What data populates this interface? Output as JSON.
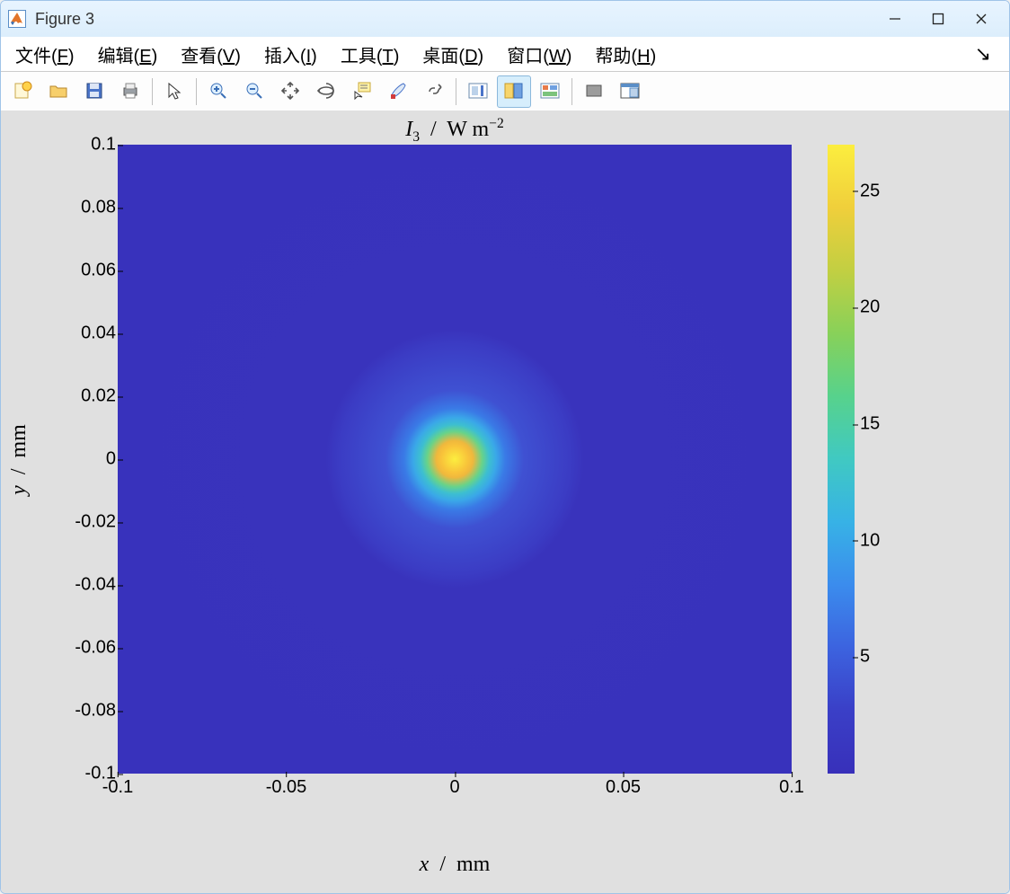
{
  "window": {
    "title": "Figure 3"
  },
  "menubar": {
    "items": [
      {
        "pre": "文件(",
        "u": "F",
        "post": ")"
      },
      {
        "pre": "编辑(",
        "u": "E",
        "post": ")"
      },
      {
        "pre": "查看(",
        "u": "V",
        "post": ")"
      },
      {
        "pre": "插入(",
        "u": "I",
        "post": ")"
      },
      {
        "pre": "工具(",
        "u": "T",
        "post": ")"
      },
      {
        "pre": "桌面(",
        "u": "D",
        "post": ")"
      },
      {
        "pre": "窗口(",
        "u": "W",
        "post": ")"
      },
      {
        "pre": "帮助(",
        "u": "H",
        "post": ")"
      }
    ]
  },
  "toolbar": {
    "buttons": [
      "new-figure",
      "open",
      "save",
      "print",
      "|",
      "pointer",
      "|",
      "zoom-in",
      "zoom-out",
      "pan",
      "rotate-3d",
      "data-cursor",
      "brush",
      "link",
      "|",
      "colorbar",
      "legend",
      "plot-tools",
      "|",
      "hide-tools",
      "dock"
    ],
    "pressed": "legend"
  },
  "chart_data": {
    "type": "heatmap",
    "title_html": "<i>I</i><span class='unit-sub'>3</span>&nbsp;&nbsp;/&nbsp; W m<span class='unit-sup'>−2</span>",
    "xlabel_html": "<i>x</i>&nbsp; /&nbsp; mm",
    "ylabel_html": "<i>y</i>&nbsp; /&nbsp; mm",
    "xlim": [
      -0.1,
      0.1
    ],
    "ylim": [
      -0.1,
      0.1
    ],
    "xticks": [
      -0.1,
      -0.05,
      0,
      0.05,
      0.1
    ],
    "yticks": [
      -0.1,
      -0.08,
      -0.06,
      -0.04,
      -0.02,
      0,
      0.02,
      0.04,
      0.06,
      0.08,
      0.1
    ],
    "colorbar": {
      "range": [
        0,
        27
      ],
      "ticks": [
        5,
        10,
        15,
        20,
        25
      ]
    },
    "description": "Circular Gaussian-like intensity spot centred at (0,0); peak ~27 W m^-2, falling to ~0 by radius ≈0.03 mm; faint diffraction ring near radius ≈0.035 mm."
  }
}
